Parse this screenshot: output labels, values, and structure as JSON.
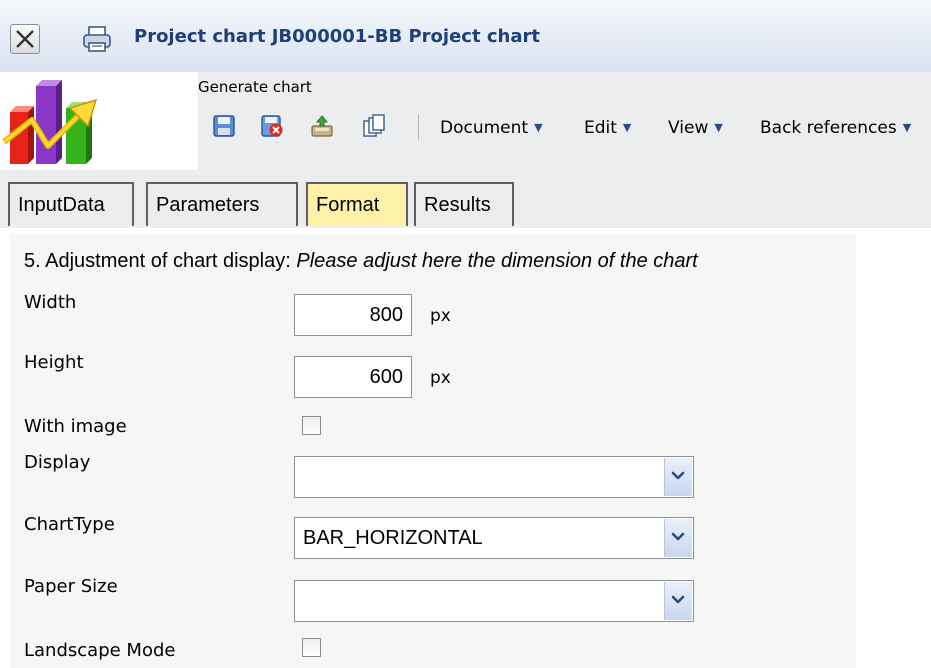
{
  "window": {
    "title": "Project chart JB000001-BB Project chart"
  },
  "toolbar": {
    "label": "Generate chart",
    "buttons": [
      "save-icon",
      "delete-icon",
      "export-icon",
      "copy-icon"
    ],
    "menus": [
      {
        "label": "Document",
        "arrow": "▼"
      },
      {
        "label": "Edit",
        "arrow": "▼"
      },
      {
        "label": "View",
        "arrow": "▼"
      },
      {
        "label": "Back references",
        "arrow": "▼"
      }
    ]
  },
  "tabs": [
    {
      "label": "InputData",
      "active": false
    },
    {
      "label": "Parameters",
      "active": false
    },
    {
      "label": "Format",
      "active": true
    },
    {
      "label": "Results",
      "active": false
    }
  ],
  "form": {
    "heading_prefix": "5. Adjustment of chart display: ",
    "heading_hint": "Please adjust here the dimension of the chart",
    "width": {
      "label": "Width",
      "value": "800",
      "unit": "px"
    },
    "height": {
      "label": "Height",
      "value": "600",
      "unit": "px"
    },
    "with_image": {
      "label": "With image",
      "checked": false
    },
    "display": {
      "label": "Display",
      "value": ""
    },
    "chart_type": {
      "label": "ChartType",
      "value": "BAR_HORIZONTAL"
    },
    "paper_size": {
      "label": "Paper Size",
      "value": ""
    },
    "landscape_mode": {
      "label": "Landscape Mode",
      "checked": false
    }
  },
  "colors": {
    "title_text": "#1d3f7a",
    "active_tab": "#fff2a8",
    "dropdown_arrow": "#2a4b86"
  }
}
